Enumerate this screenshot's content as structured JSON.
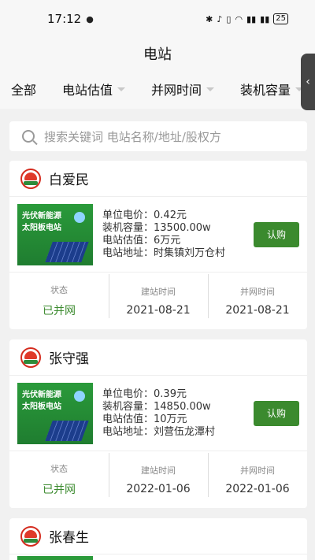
{
  "status": {
    "time": "17:12",
    "battery": "25",
    "network": "5G 4G"
  },
  "page_title": "电站",
  "filters": [
    {
      "label": "全部",
      "has_caret": false
    },
    {
      "label": "电站估值",
      "has_caret": true
    },
    {
      "label": "并网时间",
      "has_caret": true
    },
    {
      "label": "装机容量",
      "has_caret": true
    }
  ],
  "search": {
    "placeholder": "搜索关键词 电站名称/地址/股权方"
  },
  "thumb_text": {
    "line1": "光伏新能源",
    "line2": "太阳板电站"
  },
  "labels": {
    "price": "单位电价：",
    "capacity": "装机容量：",
    "valuation": "电站估值：",
    "address": "电站地址：",
    "button": "认购",
    "status": "状态",
    "build_time": "建站时间",
    "grid_time": "并网时间"
  },
  "stations": [
    {
      "owner": "白爱民",
      "price": "0.42元",
      "capacity": "13500.00w",
      "valuation": "6万元",
      "address": "时集镇刘万仓村",
      "status": "已并网",
      "build_time": "2021-08-21",
      "grid_time": "2021-08-21"
    },
    {
      "owner": "张守强",
      "price": "0.39元",
      "capacity": "14850.00w",
      "valuation": "10万元",
      "address": "刘营伍龙潭村",
      "status": "已并网",
      "build_time": "2022-01-06",
      "grid_time": "2022-01-06"
    },
    {
      "owner": "张春生"
    }
  ],
  "colors": {
    "accent": "#3b8a2e",
    "background": "#f1f1f1"
  }
}
